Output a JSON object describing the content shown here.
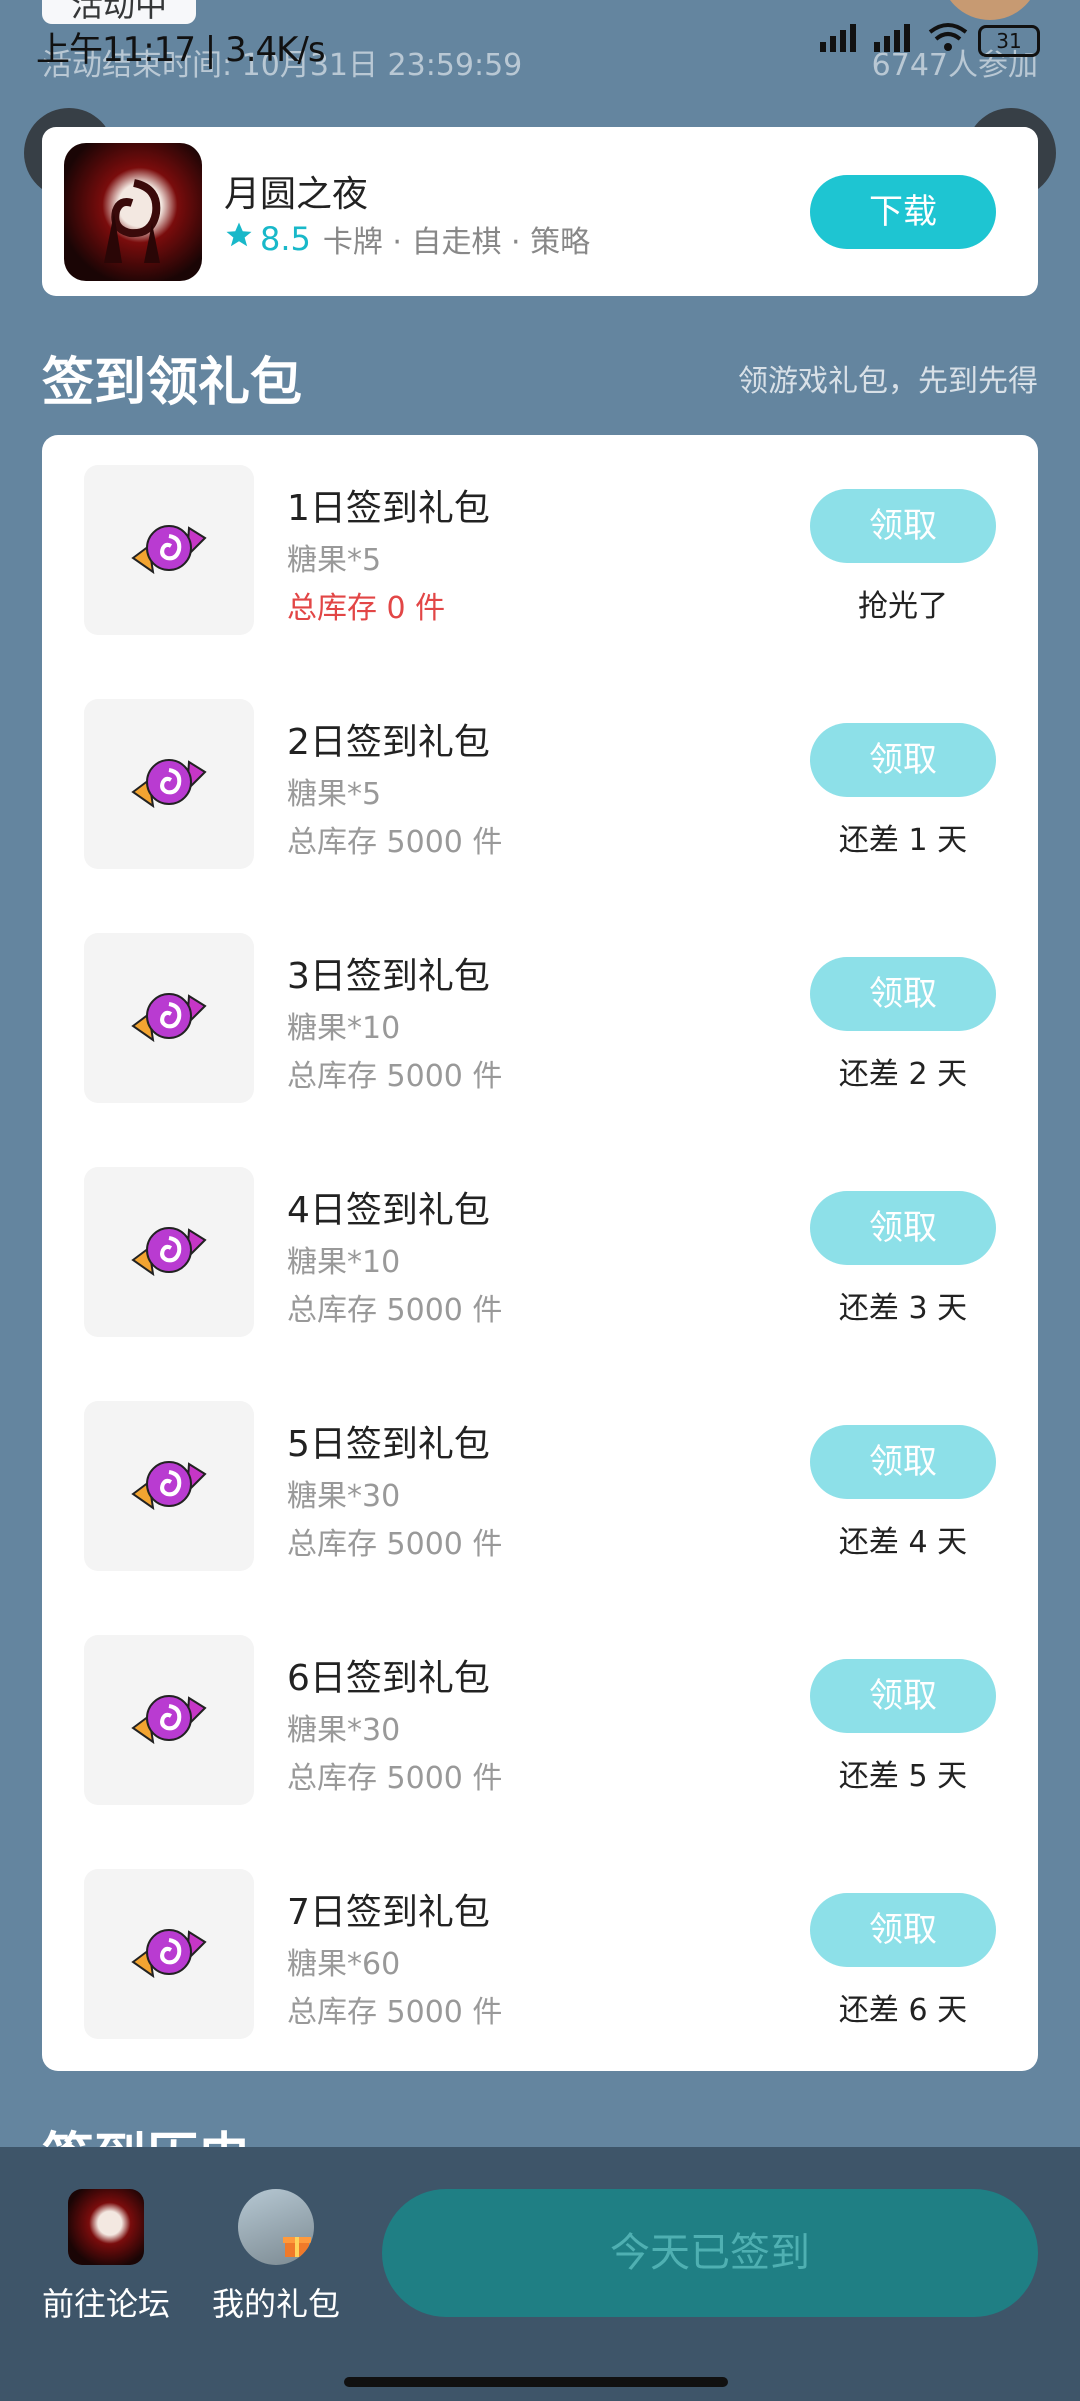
{
  "status_bar": {
    "time": "上午11:17",
    "speed": "3.4K/s",
    "battery": "31",
    "activity_tag": "活动中",
    "end_time": "活动结束时间: 10月31日 23:59:59",
    "participants": "6747人参加"
  },
  "game": {
    "title": "月圆之夜",
    "rating": "8.5",
    "tags": "卡牌 · 自走棋 · 策略",
    "download_label": "下载"
  },
  "section": {
    "title": "签到领礼包",
    "subtitle": "领游戏礼包，先到先得"
  },
  "gifts": [
    {
      "name": "1日签到礼包",
      "content": "糖果*5",
      "stock": "总库存 0 件",
      "button": "领取",
      "status": "抢光了"
    },
    {
      "name": "2日签到礼包",
      "content": "糖果*5",
      "stock": "总库存 5000 件",
      "button": "领取",
      "status": "还差 1 天"
    },
    {
      "name": "3日签到礼包",
      "content": "糖果*10",
      "stock": "总库存 5000 件",
      "button": "领取",
      "status": "还差 2 天"
    },
    {
      "name": "4日签到礼包",
      "content": "糖果*10",
      "stock": "总库存 5000 件",
      "button": "领取",
      "status": "还差 3 天"
    },
    {
      "name": "5日签到礼包",
      "content": "糖果*30",
      "stock": "总库存 5000 件",
      "button": "领取",
      "status": "还差 4 天"
    },
    {
      "name": "6日签到礼包",
      "content": "糖果*30",
      "stock": "总库存 5000 件",
      "button": "领取",
      "status": "还差 5 天"
    },
    {
      "name": "7日签到礼包",
      "content": "糖果*60",
      "stock": "总库存 5000 件",
      "button": "领取",
      "status": "还差 6 天"
    }
  ],
  "history_title": "签到历史",
  "bottom_bar": {
    "forum_label": "前往论坛",
    "my_gifts_label": "我的礼包",
    "checkin_label": "今天已签到"
  },
  "colors": {
    "background": "#64859f",
    "accent": "#1ec5d2",
    "disabled_button": "#8de0e8",
    "stock_empty": "#e24646",
    "bottom_bar": "#3e5569"
  },
  "icons": [
    "back-arrow-icon",
    "share-icon",
    "star-icon",
    "candy-icon",
    "wifi-icon",
    "signal-icon",
    "battery-icon"
  ]
}
